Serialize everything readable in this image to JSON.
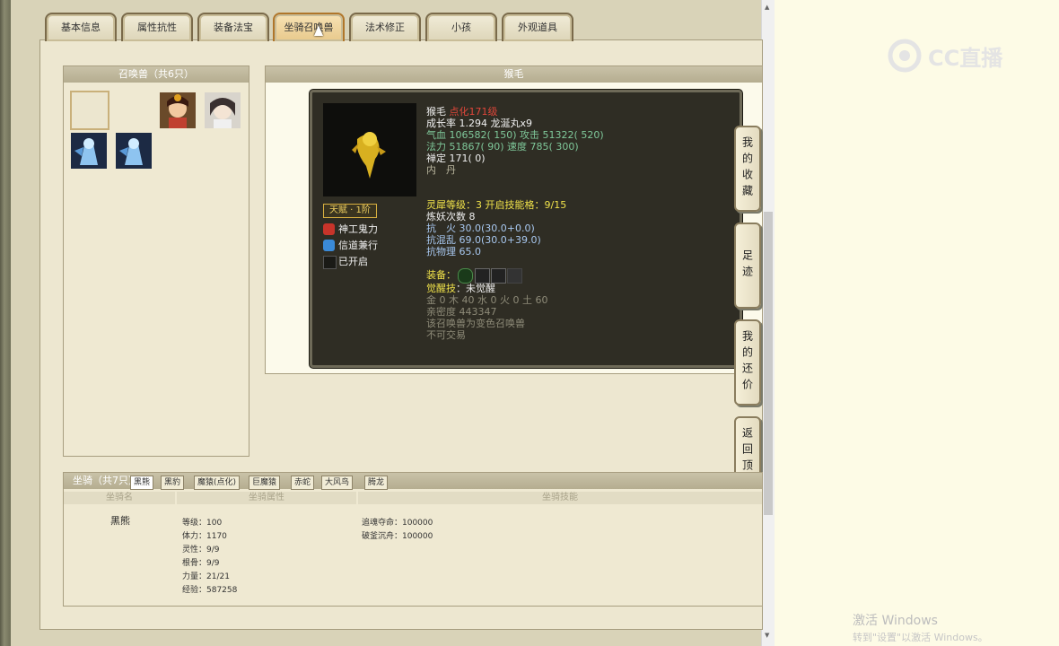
{
  "tabs": [
    "基本信息",
    "属性抗性",
    "装备法宝",
    "坐骑召唤兽",
    "法术修正",
    "小孩",
    "外观道具"
  ],
  "active_tab": "坐骑召唤兽",
  "pet_list": {
    "title": "召唤兽（共6只）"
  },
  "detail": {
    "header": "猴毛",
    "name": "猴毛",
    "name_tag": "点化171级",
    "growth": "成长率 1.294 龙涎丸x9",
    "hp_line": "气血 106582( 150) 攻击 51322( 520)",
    "mp_line": "法力 51867( 90) 速度 785( 300)",
    "calm_line": "禅定 171( 0)",
    "inner": "内　丹",
    "gift": "天赋 · 1阶",
    "skills": [
      "神工鬼力",
      "信道兼行",
      "已开启"
    ],
    "lingxi": "灵犀等级：3 开启技能格：9/15",
    "lianyao": "炼妖次数 8",
    "res_fire": "抗　火 30.0(30.0+0.0)",
    "res_chaos": "抗混乱 69.0(30.0+39.0)",
    "res_phys": "抗物理 65.0",
    "equip_label": "装备：",
    "awaken_label": "觉醒技",
    "awaken_value": "未觉醒",
    "elements": "金 0 木 40 水 0 火 0 土 60",
    "intimacy": "亲密度 443347",
    "variant": "该召唤兽为变色召唤兽",
    "no_trade": "不可交易"
  },
  "side_buttons": [
    "我的收藏",
    "足迹",
    "我的还价",
    "返回顶部"
  ],
  "mounts": {
    "title": "坐骑（共7只）",
    "tabs": [
      "黑熊",
      "黑豹",
      "魔猿(点化)",
      "巨魔猿",
      "赤蛇",
      "大风鸟",
      "腾龙"
    ],
    "col_name": "坐骑名",
    "col_attr": "坐骑属性",
    "col_skill": "坐骑技能",
    "name": "黑熊",
    "stats": [
      "等级：100",
      "体力：1170",
      "灵性：9/9",
      "根骨：9/9",
      "力量：21/21",
      "经验：587258"
    ],
    "skills": [
      "追魂夺命：100000",
      "破釜沉舟：100000"
    ]
  },
  "watermarks": {
    "logo": "CC直播",
    "activate": "激活 Windows",
    "activate_sub": "转到\"设置\"以激活 Windows。"
  }
}
